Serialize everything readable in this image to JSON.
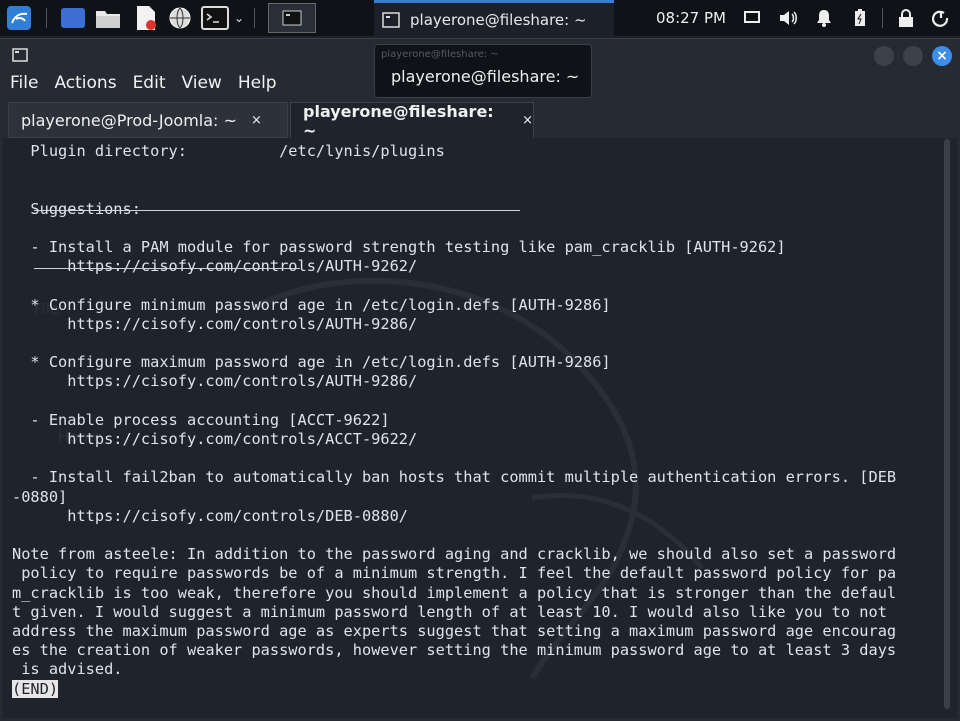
{
  "panel": {
    "active_task": "playerone@fileshare: ~",
    "clock": "08:27 PM"
  },
  "window": {
    "tooltip": "playerone@fileshare: ~",
    "tooltip_ghost": "playerone@fileshare: ~",
    "menu": [
      "File",
      "Actions",
      "Edit",
      "View",
      "Help"
    ],
    "tabs": [
      {
        "label": "playerone@Prod-Joomla: ~",
        "close": "×"
      },
      {
        "label": "playerone@fileshare: ~",
        "close": "×"
      }
    ]
  },
  "terminal": {
    "lines": [
      "  Plugin directory:          /etc/lynis/plugins",
      "",
      "",
      "  Suggestions:",
      "",
      "  - Install a PAM module for password strength testing like pam_cracklib [AUTH-9262]",
      "      https://cisofy.com/controls/AUTH-9262/",
      "",
      "  * Configure minimum password age in /etc/login.defs [AUTH-9286]",
      "      https://cisofy.com/controls/AUTH-9286/",
      "",
      "  * Configure maximum password age in /etc/login.defs [AUTH-9286]",
      "      https://cisofy.com/controls/AUTH-9286/",
      "",
      "  - Enable process accounting [ACCT-9622]",
      "      https://cisofy.com/controls/ACCT-9622/",
      "",
      "  - Install fail2ban to automatically ban hosts that commit multiple authentication errors. [DEB",
      "-0880]",
      "      https://cisofy.com/controls/DEB-0880/",
      "",
      "Note from asteele: In addition to the password aging and cracklib, we should also set a password",
      " policy to require passwords be of a minimum strength. I feel the default password policy for pa",
      "m_cracklib is too weak, therefore you should implement a policy that is stronger than the defaul",
      "t given. I would suggest a minimum password length of at least 10. I would also like you to not",
      "address the maximum password age as experts suggest that setting a maximum password age encourag",
      "es the creation of weaker passwords, however setting the minimum password age to at least 3 days",
      " is advised."
    ],
    "end_marker": "(END)",
    "watermark_labels": [
      "File",
      "Home"
    ]
  }
}
